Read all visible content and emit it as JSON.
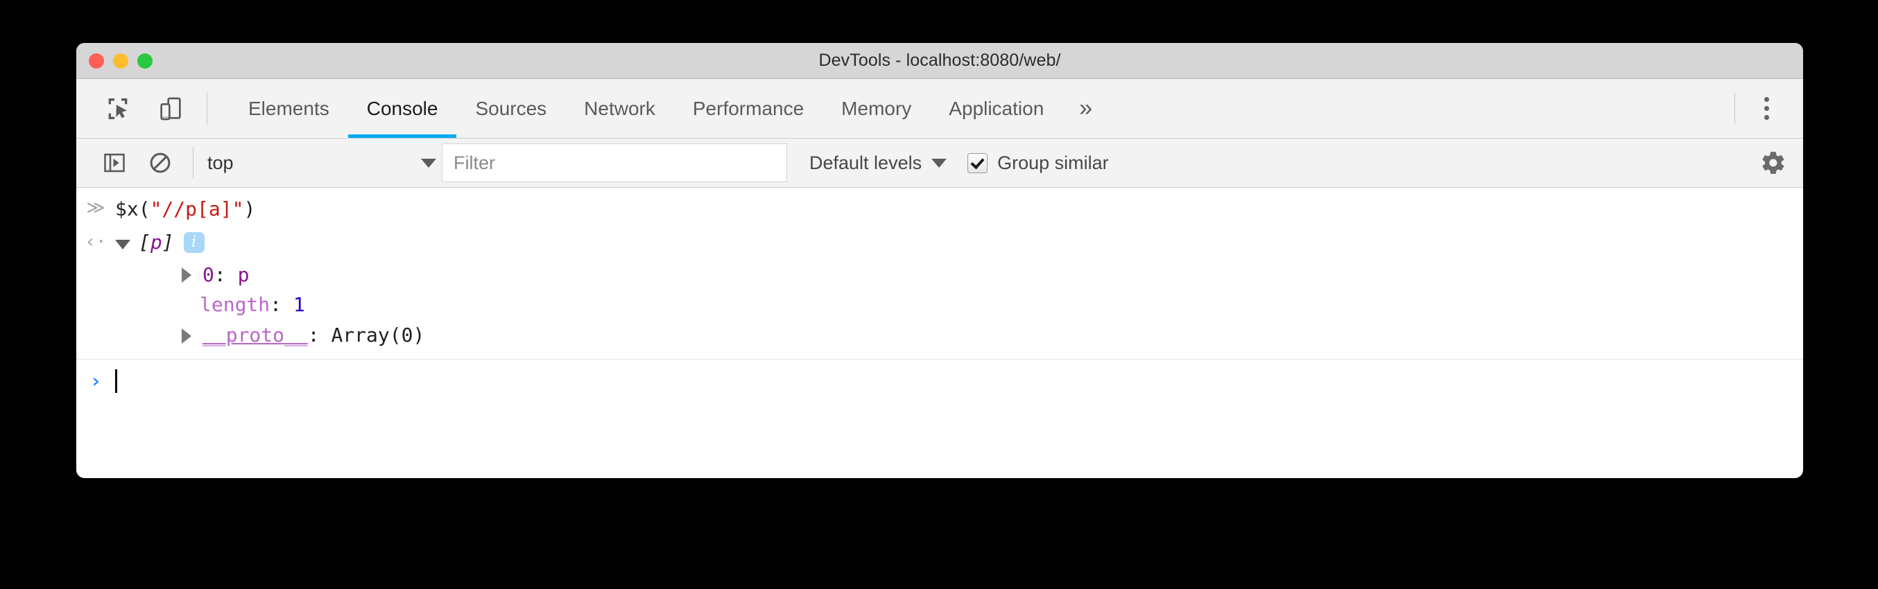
{
  "window": {
    "title": "DevTools - localhost:8080/web/",
    "traffic_lights": [
      {
        "name": "close",
        "color": "#ff5f57"
      },
      {
        "name": "minimize",
        "color": "#ffbd2e"
      },
      {
        "name": "zoom",
        "color": "#28c840"
      }
    ]
  },
  "theme": {
    "accent": "#03a9f4",
    "titlebar_bg": "#d6d6d6",
    "toolbar_bg": "#f3f3f3",
    "panel_bg": "#ffffff",
    "string_color": "#c41a16",
    "number_color": "#1c00cf",
    "key_color": "#881391",
    "key_light_color": "#b868c9",
    "info_badge_bg": "#a8d7f7",
    "prompt_color": "#1a8cff"
  },
  "tab_bar": {
    "inspect_icon": "inspect-element-icon",
    "device_icon": "device-toolbar-icon",
    "tabs": [
      {
        "label": "Elements",
        "active": false
      },
      {
        "label": "Console",
        "active": true
      },
      {
        "label": "Sources",
        "active": false
      },
      {
        "label": "Network",
        "active": false
      },
      {
        "label": "Performance",
        "active": false
      },
      {
        "label": "Memory",
        "active": false
      },
      {
        "label": "Application",
        "active": false
      }
    ],
    "more_tabs_label": "»",
    "menu_icon": "kebab-menu-icon"
  },
  "console_toolbar": {
    "sidebar_icon": "console-sidebar-toggle-icon",
    "clear_icon": "clear-console-icon",
    "context": {
      "value": "top",
      "caret": "chevron-down-icon"
    },
    "filter": {
      "value": "",
      "placeholder": "Filter"
    },
    "levels": {
      "label": "Default levels",
      "caret": "chevron-down-icon"
    },
    "group_similar": {
      "label": "Group similar",
      "checked": true
    },
    "settings_icon": "gear-icon"
  },
  "console": {
    "command": {
      "gutter": "≫",
      "prefix": "$x(",
      "string": "\"//p[a]\"",
      "suffix": ")"
    },
    "result": {
      "gutter": "‹·",
      "open_bracket": "[",
      "node_name": "p",
      "close_bracket": "]",
      "info_badge": "i"
    },
    "properties": [
      {
        "expandable": true,
        "key": "0",
        "key_style": "key",
        "separator": ": ",
        "value": "p",
        "value_style": "node"
      },
      {
        "expandable": false,
        "key": "length",
        "key_style": "key-light",
        "separator": ": ",
        "value": "1",
        "value_style": "number"
      },
      {
        "expandable": true,
        "key": "__proto__",
        "key_style": "key-light-underline",
        "separator": ": ",
        "value": "Array(0)",
        "value_style": "plain"
      }
    ],
    "prompt": {
      "chevron": "›",
      "input_value": ""
    }
  }
}
